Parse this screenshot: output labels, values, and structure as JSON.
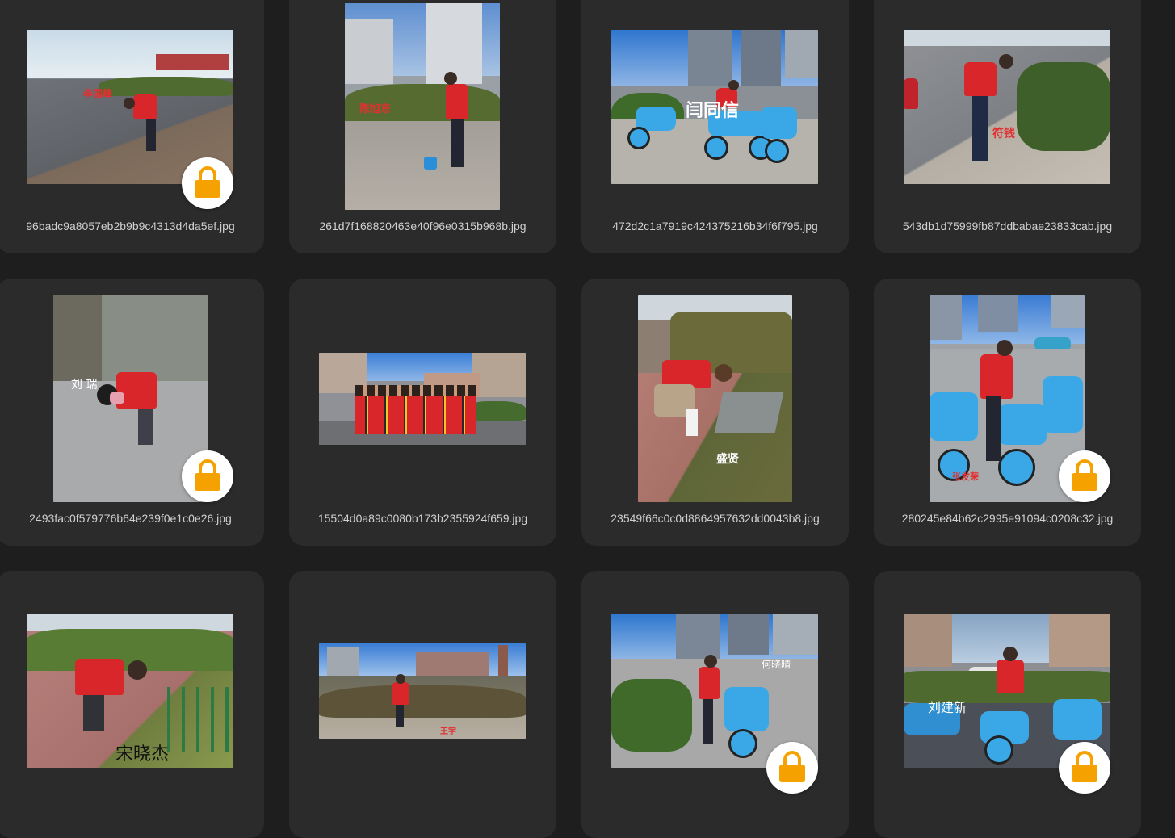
{
  "gallery": {
    "items": [
      {
        "filename": "96badc9a8057eb2b9b9c4313d4da5ef.jpg",
        "overlay_name": "李国峰",
        "locked": true,
        "icon": "lock-icon"
      },
      {
        "filename": "261d7f168820463e40f96e0315b968b.jpg",
        "overlay_name": "陈旭东",
        "locked": false
      },
      {
        "filename": "472d2c1a7919c424375216b34f6f795.jpg",
        "overlay_name": "闫同信",
        "locked": false
      },
      {
        "filename": "543db1d75999fb87ddbabae23833cab.jpg",
        "overlay_name": "符钱",
        "locked": false
      },
      {
        "filename": "2493fac0f579776b64e239f0e1c0e26.jpg",
        "overlay_name": "刘 瑞",
        "locked": true,
        "icon": "lock-icon"
      },
      {
        "filename": "15504d0a89c0080b173b2355924f659.jpg",
        "overlay_name": "",
        "locked": false
      },
      {
        "filename": "23549f66c0c0d8864957632dd0043b8.jpg",
        "overlay_name": "盛贤",
        "locked": false
      },
      {
        "filename": "280245e84b62c2995e91094c0208c32.jpg",
        "overlay_name": "张发荣",
        "locked": true,
        "icon": "lock-icon"
      },
      {
        "filename": "",
        "overlay_name": "宋晓杰",
        "locked": false
      },
      {
        "filename": "",
        "overlay_name": "王宇",
        "locked": false
      },
      {
        "filename": "",
        "overlay_name": "何晓晴",
        "locked": true,
        "icon": "lock-icon"
      },
      {
        "filename": "",
        "overlay_name": "刘建新",
        "locked": true,
        "icon": "lock-icon"
      }
    ]
  },
  "colors": {
    "background": "#1e1e1e",
    "card": "#2b2b2b",
    "filename_text": "#d0d0d0",
    "lock_accent": "#f5a200"
  }
}
